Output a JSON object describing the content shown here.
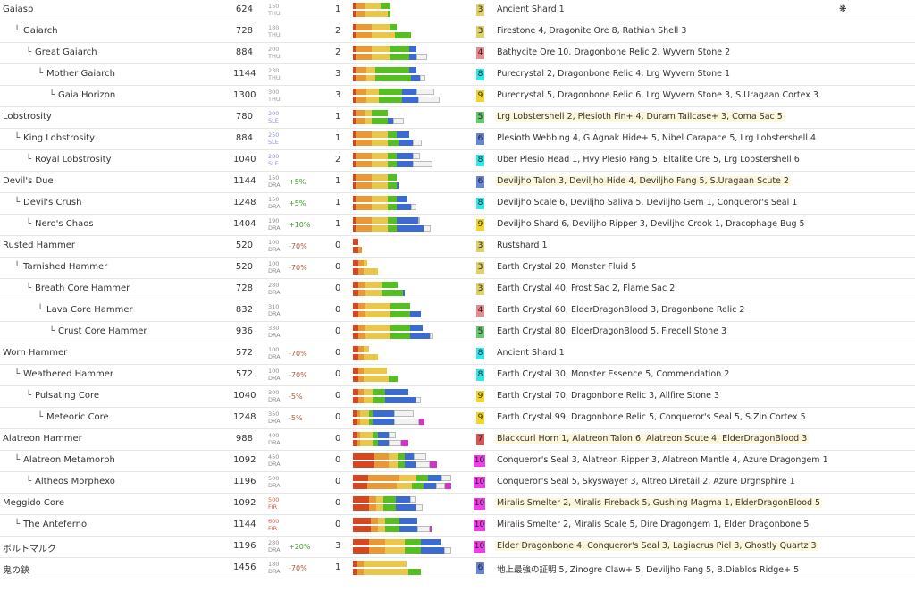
{
  "colors": {
    "sharp_red": "#d9451f",
    "sharp_orange": "#e89834",
    "sharp_yellow": "#e9c74a",
    "sharp_green": "#55bf22",
    "sharp_blue": "#3b6ad2",
    "sharp_white": "#f2f2f2",
    "sharp_purple": "#d235c8",
    "thunder": "#999999",
    "slime": "#8e92d6",
    "dragon": "#8d8d8d",
    "fire": "#e0573b",
    "affinity_pos": "#3c9b2a",
    "affinity_neg": "#a1613e"
  },
  "rarity_colors": {
    "3": "#dcd269",
    "4": "#e98a8e",
    "5": "#68c670",
    "6": "#6a85d8",
    "7": "#d85555",
    "8": "#2ee9e9",
    "9": "#f3d523",
    "10": "#ee3eea"
  },
  "rows": [
    {
      "name": "Gaiasp",
      "depth": 0,
      "attack": "624",
      "el_val": "150",
      "el_type": "THU",
      "el_color": "thunder",
      "affinity": "",
      "slots": "1",
      "rarity": "3",
      "materials": "Ancient Shard 1",
      "highlight": false,
      "star": "❋",
      "sharp": [
        [
          3,
          10,
          18,
          11
        ],
        [
          3,
          10,
          26,
          3
        ]
      ]
    },
    {
      "name": "Gaiarch",
      "depth": 1,
      "attack": "728",
      "el_val": "180",
      "el_type": "THU",
      "el_color": "thunder",
      "affinity": "",
      "slots": "2",
      "rarity": "3",
      "materials": "Firestone 4, Dragonite Ore 8, Rathian Shell 3",
      "highlight": false,
      "sharp": [
        [
          3,
          18,
          20,
          8
        ],
        [
          3,
          18,
          26,
          18
        ]
      ]
    },
    {
      "name": "Great Gaiarch",
      "depth": 2,
      "attack": "884",
      "el_val": "200",
      "el_type": "THU",
      "el_color": "thunder",
      "affinity": "",
      "slots": "2",
      "rarity": "4",
      "materials": "Bathycite Ore 10, Dragonbone Relic 2, Wyvern Stone 2",
      "highlight": false,
      "sharp": [
        [
          3,
          18,
          20,
          22,
          8
        ],
        [
          3,
          18,
          20,
          22,
          8,
          12
        ]
      ]
    },
    {
      "name": "Mother Gaiarch",
      "depth": 3,
      "attack": "1144",
      "el_val": "230",
      "el_type": "THU",
      "el_color": "thunder",
      "affinity": "",
      "slots": "3",
      "rarity": "8",
      "materials": "Purecrystal 2, Dragonbone Relic 4, Lrg Wyvern Stone 1",
      "highlight": false,
      "sharp": [
        [
          3,
          12,
          10,
          38,
          8
        ],
        [
          3,
          12,
          10,
          40,
          10,
          6
        ]
      ]
    },
    {
      "name": "Gaia Horizon",
      "depth": 4,
      "attack": "1300",
      "el_val": "300",
      "el_type": "THU",
      "el_color": "thunder",
      "affinity": "",
      "slots": "3",
      "rarity": "9",
      "materials": "Purecrystal 5, Dragonbone Relic 6, Lrg Wyvern Stone 3, S.Uragaan Cortex 3",
      "highlight": false,
      "sharp": [
        [
          3,
          12,
          14,
          26,
          16,
          20
        ],
        [
          3,
          12,
          14,
          26,
          18,
          24
        ]
      ]
    },
    {
      "name": "Lobstrosity",
      "depth": 0,
      "attack": "780",
      "el_val": "200",
      "el_type": "SLE",
      "el_color": "slime",
      "affinity": "",
      "slots": "1",
      "rarity": "5",
      "materials": "Lrg Lobstershell 2, Plesioth Fin+ 4, Duram Tailcase+ 3, Coma Sac 5",
      "highlight": true,
      "sharp": [
        [
          3,
          10,
          8,
          18
        ],
        [
          3,
          10,
          8,
          18,
          6,
          12
        ]
      ]
    },
    {
      "name": "King Lobstrosity",
      "depth": 1,
      "attack": "884",
      "el_val": "250",
      "el_type": "SLE",
      "el_color": "slime",
      "affinity": "",
      "slots": "1",
      "rarity": "6",
      "materials": "Plesioth Webbing 4, G.Agnak Hide+ 5, Nibel Carapace 5, Lrg Lobstershell 4",
      "highlight": false,
      "sharp": [
        [
          3,
          18,
          18,
          10,
          14
        ],
        [
          3,
          18,
          18,
          12,
          16,
          10
        ]
      ]
    },
    {
      "name": "Royal Lobstrosity",
      "depth": 2,
      "attack": "1040",
      "el_val": "280",
      "el_type": "SLE",
      "el_color": "slime",
      "affinity": "",
      "slots": "2",
      "rarity": "8",
      "materials": "Uber Plesio Head 1, Hvy Plesio Fang 5, Eltalite Ore 5, Lrg Lobstershell 6",
      "highlight": false,
      "sharp": [
        [
          3,
          18,
          18,
          10,
          18,
          8
        ],
        [
          3,
          18,
          18,
          10,
          18,
          22
        ]
      ]
    },
    {
      "name": "Devil's Due",
      "depth": 0,
      "attack": "1144",
      "el_val": "150",
      "el_type": "DRA",
      "el_color": "dragon",
      "affinity": "+5%",
      "slots": "1",
      "rarity": "6",
      "materials": "Deviljho Talon 3, Deviljho Hide 4, Deviljho Fang 5, S.Uragaan Scute 2",
      "highlight": true,
      "sharp": [
        [
          3,
          18,
          18,
          10
        ],
        [
          3,
          18,
          18,
          10,
          2
        ]
      ]
    },
    {
      "name": "Devil's Crush",
      "depth": 1,
      "attack": "1248",
      "el_val": "150",
      "el_type": "DRA",
      "el_color": "dragon",
      "affinity": "+5%",
      "slots": "1",
      "rarity": "8",
      "materials": "Deviljho Scale 6, Deviljho Saliva 5, Deviljho Gem 1, Conqueror's Seal 1",
      "highlight": false,
      "sharp": [
        [
          3,
          18,
          18,
          10,
          12
        ],
        [
          3,
          18,
          18,
          10,
          16,
          6
        ]
      ]
    },
    {
      "name": "Nero's Chaos",
      "depth": 2,
      "attack": "1404",
      "el_val": "190",
      "el_type": "DRA",
      "el_color": "dragon",
      "affinity": "+10%",
      "slots": "1",
      "rarity": "9",
      "materials": "Deviljho Shard 6, Deviljho Ripper 3, Deviljho Crook 1, Dracophage Bug 5",
      "highlight": false,
      "sharp": [
        [
          3,
          18,
          18,
          10,
          24,
          2
        ],
        [
          3,
          18,
          18,
          10,
          30,
          8
        ]
      ]
    },
    {
      "name": "Rusted Hammer",
      "depth": 0,
      "attack": "520",
      "el_val": "100",
      "el_type": "DRA",
      "el_color": "dragon",
      "affinity": "-70%",
      "slots": "0",
      "rarity": "3",
      "materials": "Rustshard 1",
      "highlight": false,
      "sharp": [
        [
          6
        ],
        [
          6,
          4
        ]
      ]
    },
    {
      "name": "Tarnished Hammer",
      "depth": 1,
      "attack": "520",
      "el_val": "100",
      "el_type": "DRA",
      "el_color": "dragon",
      "affinity": "-70%",
      "slots": "0",
      "rarity": "3",
      "materials": "Earth Crystal 20, Monster Fluid 5",
      "highlight": false,
      "sharp": [
        [
          6,
          6,
          4
        ],
        [
          6,
          6,
          16
        ]
      ]
    },
    {
      "name": "Breath Core Hammer",
      "depth": 2,
      "attack": "728",
      "el_val": "280",
      "el_type": "DRA",
      "el_color": "dragon",
      "affinity": "",
      "slots": "0",
      "rarity": "3",
      "materials": "Earth Crystal 40, Frost Sac 2, Flame Sac 2",
      "highlight": false,
      "sharp": [
        [
          6,
          8,
          18,
          18
        ],
        [
          6,
          8,
          18,
          24,
          2
        ]
      ]
    },
    {
      "name": "Lava Core Hammer",
      "depth": 3,
      "attack": "832",
      "el_val": "310",
      "el_type": "DRA",
      "el_color": "dragon",
      "affinity": "",
      "slots": "0",
      "rarity": "4",
      "materials": "Earth Crystal 60, ElderDragonBlood 3, Dragonbone Relic 2",
      "highlight": false,
      "sharp": [
        [
          6,
          8,
          28,
          22
        ],
        [
          6,
          8,
          28,
          22,
          12
        ]
      ]
    },
    {
      "name": "Crust Core Hammer",
      "depth": 4,
      "attack": "936",
      "el_val": "330",
      "el_type": "DRA",
      "el_color": "dragon",
      "affinity": "",
      "slots": "0",
      "rarity": "5",
      "materials": "Earth Crystal 80, ElderDragonBlood 5, Firecell Stone 3",
      "highlight": false,
      "sharp": [
        [
          6,
          8,
          28,
          22,
          14
        ],
        [
          6,
          8,
          28,
          22,
          22,
          4
        ]
      ]
    },
    {
      "name": "Worn Hammer",
      "depth": 0,
      "attack": "572",
      "el_val": "100",
      "el_type": "DRA",
      "el_color": "dragon",
      "affinity": "-70%",
      "slots": "0",
      "rarity": "8",
      "materials": "Ancient Shard 1",
      "highlight": false,
      "sharp": [
        [
          6,
          6,
          6
        ],
        [
          6,
          6,
          16
        ]
      ]
    },
    {
      "name": "Weathered Hammer",
      "depth": 1,
      "attack": "572",
      "el_val": "100",
      "el_type": "DRA",
      "el_color": "dragon",
      "affinity": "-70%",
      "slots": "0",
      "rarity": "8",
      "materials": "Earth Crystal 30, Monster Essence 5, Commendation 2",
      "highlight": false,
      "sharp": [
        [
          6,
          6,
          26
        ],
        [
          6,
          6,
          28,
          10
        ]
      ]
    },
    {
      "name": "Pulsating Core",
      "depth": 2,
      "attack": "1040",
      "el_val": "300",
      "el_type": "DRA",
      "el_color": "dragon",
      "affinity": "-5%",
      "slots": "0",
      "rarity": "9",
      "materials": "Earth Crystal 70, Dragonbone Relic 3, Allfire Stone 3",
      "highlight": false,
      "sharp": [
        [
          6,
          6,
          10,
          14,
          26
        ],
        [
          6,
          6,
          10,
          14,
          34,
          6
        ]
      ]
    },
    {
      "name": "Meteoric Core",
      "depth": 3,
      "attack": "1248",
      "el_val": "350",
      "el_type": "DRA",
      "el_color": "dragon",
      "affinity": "-5%",
      "slots": "0",
      "rarity": "9",
      "materials": "Earth Crystal 99, Dragonbone Relic 5, Conqueror's Seal 5, S.Zin Cortex 5",
      "highlight": false,
      "sharp": [
        [
          4,
          4,
          10,
          4,
          24,
          22
        ],
        [
          4,
          4,
          10,
          4,
          24,
          28,
          6
        ]
      ]
    },
    {
      "name": "Alatreon Hammer",
      "depth": 0,
      "attack": "988",
      "el_val": "400",
      "el_type": "DRA",
      "el_color": "dragon",
      "affinity": "",
      "slots": "0",
      "rarity": "7",
      "materials": "Blackcurl Horn 1, Alatreon Talon 6, Alatreon Scute 4, ElderDragonBlood 3",
      "highlight": true,
      "sharp": [
        [
          4,
          4,
          14,
          6,
          12,
          8
        ],
        [
          4,
          4,
          14,
          6,
          12,
          14,
          8
        ]
      ]
    },
    {
      "name": "Alatreon Metamorph",
      "depth": 1,
      "attack": "1092",
      "el_val": "450",
      "el_type": "DRA",
      "el_color": "dragon",
      "affinity": "",
      "slots": "0",
      "rarity": "10",
      "materials": "Conqueror's Seal 3, Alatreon Ripper 3, Alatreon Mantle 4, Azure Dragongem 1",
      "highlight": false,
      "sharp": [
        [
          24,
          16,
          10,
          8,
          10,
          14
        ],
        [
          24,
          16,
          10,
          8,
          12,
          16,
          8
        ]
      ]
    },
    {
      "name": "Altheos Morphexo",
      "depth": 2,
      "attack": "1196",
      "el_val": "500",
      "el_type": "DRA",
      "el_color": "dragon",
      "affinity": "",
      "slots": "0",
      "rarity": "10",
      "materials": "Conqueror's Seal 5, Skyswayer 3, Altreo Diretail 2, Azure Drgnsphire 1",
      "highlight": false,
      "sharp": [
        [
          18,
          38,
          20,
          14,
          16,
          12
        ],
        [
          18,
          38,
          20,
          14,
          16,
          12,
          8
        ]
      ]
    },
    {
      "name": "Meggido Core",
      "depth": 0,
      "attack": "1092",
      "el_val": "500",
      "el_type": "FIR",
      "el_color": "fire",
      "affinity": "",
      "slots": "0",
      "rarity": "10",
      "materials": "Miralis Smelter 2, Miralis Fireback 5, Gushing Magma 1, ElderDragonBlood 5",
      "highlight": true,
      "sharp": [
        [
          18,
          8,
          8,
          14,
          16,
          6
        ],
        [
          18,
          8,
          8,
          14,
          22,
          8
        ]
      ]
    },
    {
      "name": "The Anteferno",
      "depth": 1,
      "attack": "1144",
      "el_val": "600",
      "el_type": "FIR",
      "el_color": "fire",
      "affinity": "",
      "slots": "0",
      "rarity": "10",
      "materials": "Miralis Smelter 2, Miralis Scale 5, Dire Dragongem 1, Elder Dragonbone 5",
      "highlight": false,
      "sharp": [
        [
          20,
          8,
          8,
          16,
          20
        ],
        [
          20,
          8,
          8,
          16,
          20,
          14,
          2
        ]
      ]
    },
    {
      "name": "ボルトマルク",
      "depth": 0,
      "attack": "1196",
      "el_val": "280",
      "el_type": "DRA",
      "el_color": "dragon",
      "affinity": "+20%",
      "slots": "3",
      "rarity": "10",
      "materials": "Elder Dragonbone 4, Conqueror's Seal 3, Lagiacrus Piel 3, Ghostly Quartz 3",
      "highlight": true,
      "sharp": [
        [
          18,
          18,
          22,
          18,
          22
        ],
        [
          18,
          18,
          22,
          18,
          26,
          8
        ]
      ]
    },
    {
      "name": "鬼の鋏",
      "depth": 0,
      "attack": "1456",
      "el_val": "180",
      "el_type": "DRA",
      "el_color": "dragon",
      "affinity": "-70%",
      "slots": "1",
      "rarity": "6",
      "materials": "地上最強の証明 5, Zinogre Claw+ 5, Deviljho Fang 5, B.Diablos Ridge+ 5",
      "highlight": false,
      "sharp": [
        [
          4,
          8,
          48
        ],
        [
          4,
          8,
          50,
          14
        ]
      ]
    }
  ]
}
